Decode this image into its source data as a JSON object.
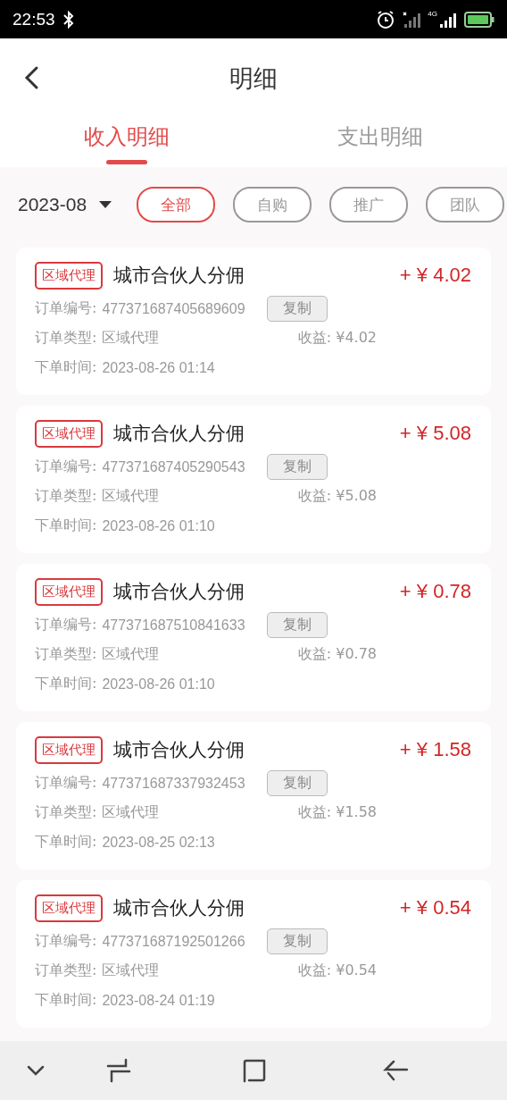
{
  "status_bar": {
    "time": "22:53",
    "network": "4G"
  },
  "header": {
    "title": "明细"
  },
  "tabs": [
    {
      "label": "收入明细",
      "selected": true
    },
    {
      "label": "支出明细",
      "selected": false
    }
  ],
  "filter": {
    "month": "2023-08",
    "chips": [
      {
        "label": "全部",
        "selected": true
      },
      {
        "label": "自购",
        "selected": false
      },
      {
        "label": "推广",
        "selected": false
      },
      {
        "label": "团队",
        "selected": false
      }
    ]
  },
  "records": [
    {
      "tag": "区域代理",
      "title": "城市合伙人分佣",
      "amount": "+ ¥ 4.02",
      "order_no_label": "订单编号:",
      "order_no": "477371687405689609",
      "copy": "复制",
      "type_label": "订单类型:",
      "type": "区域代理",
      "income": "收益: ¥4.02",
      "time_label": "下单时间:",
      "time": "2023-08-26 01:14"
    },
    {
      "tag": "区域代理",
      "title": "城市合伙人分佣",
      "amount": "+ ¥ 5.08",
      "order_no_label": "订单编号:",
      "order_no": "477371687405290543",
      "copy": "复制",
      "type_label": "订单类型:",
      "type": "区域代理",
      "income": "收益: ¥5.08",
      "time_label": "下单时间:",
      "time": "2023-08-26 01:10"
    },
    {
      "tag": "区域代理",
      "title": "城市合伙人分佣",
      "amount": "+ ¥ 0.78",
      "order_no_label": "订单编号:",
      "order_no": "477371687510841633",
      "copy": "复制",
      "type_label": "订单类型:",
      "type": "区域代理",
      "income": "收益: ¥0.78",
      "time_label": "下单时间:",
      "time": "2023-08-26 01:10"
    },
    {
      "tag": "区域代理",
      "title": "城市合伙人分佣",
      "amount": "+ ¥ 1.58",
      "order_no_label": "订单编号:",
      "order_no": "477371687337932453",
      "copy": "复制",
      "type_label": "订单类型:",
      "type": "区域代理",
      "income": "收益: ¥1.58",
      "time_label": "下单时间:",
      "time": "2023-08-25 02:13"
    },
    {
      "tag": "区域代理",
      "title": "城市合伙人分佣",
      "amount": "+ ¥ 0.54",
      "order_no_label": "订单编号:",
      "order_no": "477371687192501266",
      "copy": "复制",
      "type_label": "订单类型:",
      "type": "区域代理",
      "income": "收益: ¥0.54",
      "time_label": "下单时间:",
      "time": "2023-08-24 01:19"
    }
  ]
}
